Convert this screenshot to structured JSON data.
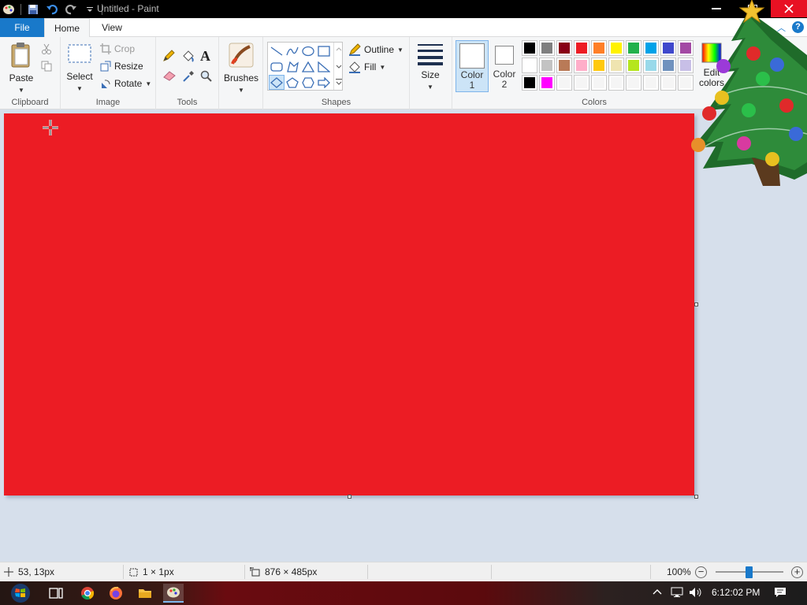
{
  "window": {
    "title": "Untitled - Paint"
  },
  "tabs": {
    "file": "File",
    "home": "Home",
    "view": "View"
  },
  "help_label": "?",
  "ribbon": {
    "clipboard": {
      "label": "Clipboard",
      "paste": "Paste"
    },
    "image": {
      "label": "Image",
      "select": "Select",
      "crop": "Crop",
      "resize": "Resize",
      "rotate": "Rotate"
    },
    "tools": {
      "label": "Tools"
    },
    "brushes": {
      "label": "Brushes"
    },
    "shapes": {
      "label": "Shapes",
      "outline": "Outline",
      "fill": "Fill"
    },
    "size": {
      "label": "Size"
    },
    "colors": {
      "label": "Colors",
      "color1": "Color 1",
      "color2": "Color 2",
      "edit_colors": "Edit colors",
      "palette_row1": [
        "#000000",
        "#7f7f7f",
        "#880015",
        "#ed1c24",
        "#ff7f27",
        "#fff200",
        "#22b14c",
        "#00a2e8",
        "#3f48cc",
        "#a349a4"
      ],
      "palette_row2": [
        "#ffffff",
        "#c3c3c3",
        "#b97a57",
        "#ffaec9",
        "#ffc90e",
        "#efe4b0",
        "#b5e61d",
        "#99d9ea",
        "#7092be",
        "#c8bfe7"
      ],
      "palette_row3": [
        "#000000",
        "#ff00ff",
        "#f5f5f5",
        "#f5f5f5",
        "#f5f5f5",
        "#f5f5f5",
        "#f5f5f5",
        "#f5f5f5",
        "#f5f5f5",
        "#f5f5f5"
      ]
    }
  },
  "canvas": {
    "fill_color": "#ec1c24"
  },
  "status": {
    "cursor_pos": "53, 13px",
    "selection_size": "1 × 1px",
    "canvas_size": "876 × 485px",
    "zoom": "100%"
  },
  "taskbar": {
    "time": "6:12:02 PM"
  }
}
